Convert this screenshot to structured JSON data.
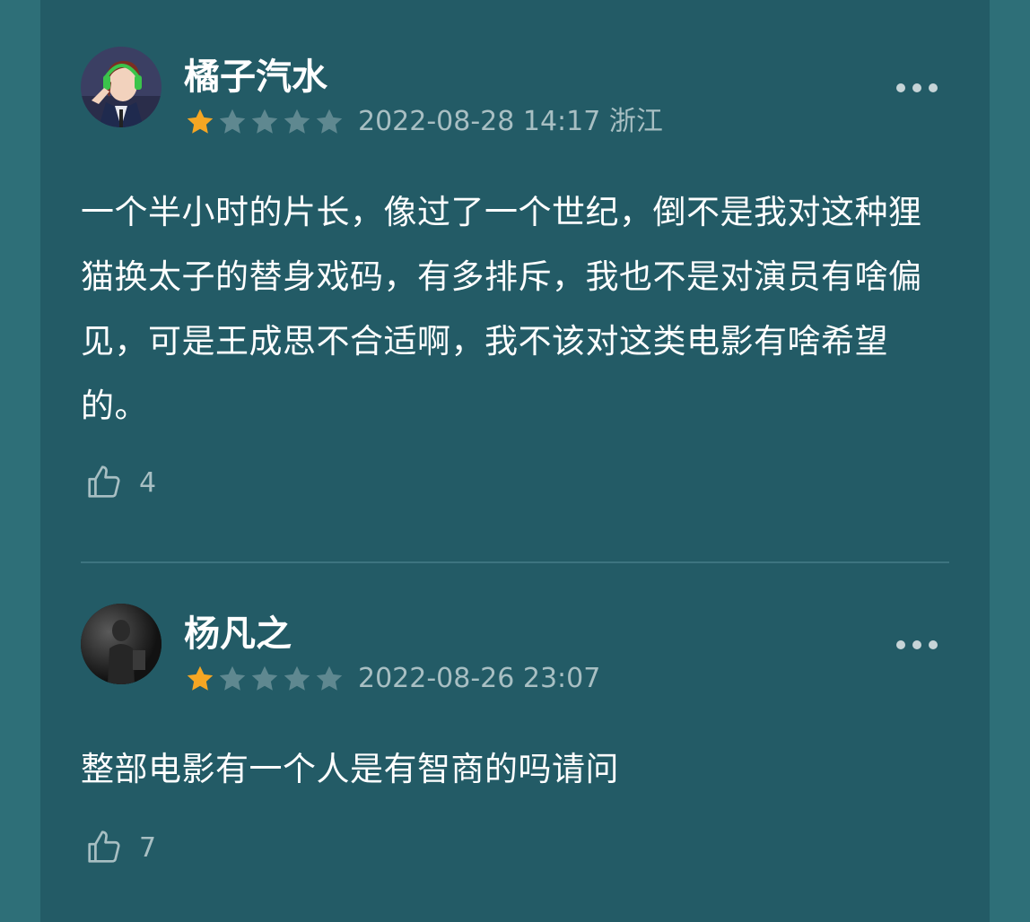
{
  "colors": {
    "background": "#2e6f78",
    "panel": "#235b66",
    "star_filled": "#f5a623",
    "star_empty": "#5f8890",
    "meta_text": "#a8bfc3"
  },
  "comments": [
    {
      "username": "橘子汽水",
      "rating": 1,
      "max_rating": 5,
      "meta": "2022-08-28 14:17 浙江",
      "content": "一个半小时的片长，像过了一个世纪，倒不是我对这种狸猫换太子的替身戏码，有多排斥，我也不是对演员有啥偏见，可是王成思不合适啊，我不该对这类电影有啥希望的。",
      "likes": "4",
      "avatar_icon": "anime-character-avatar-icon",
      "like_icon": "thumbs-up-icon",
      "more_icon": "more-dots-icon"
    },
    {
      "username": "杨凡之",
      "rating": 1,
      "max_rating": 5,
      "meta": "2022-08-26 23:07",
      "content": "整部电影有一个人是有智商的吗请问",
      "likes": "7",
      "avatar_icon": "dark-silhouette-avatar-icon",
      "like_icon": "thumbs-up-icon",
      "more_icon": "more-dots-icon"
    }
  ]
}
